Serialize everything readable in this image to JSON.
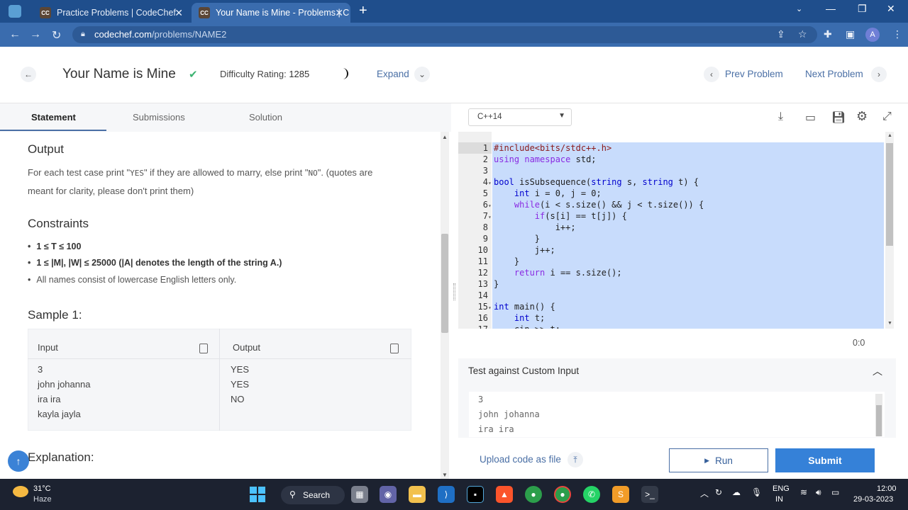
{
  "browser": {
    "tabs": [
      {
        "favicon": "CC",
        "title": "Practice Problems | CodeChef"
      },
      {
        "favicon": "CC",
        "title": "Your Name is Mine - Problems | C"
      }
    ],
    "url_host": "codechef.com",
    "url_path": "/problems/NAME2",
    "profile_initial": "A"
  },
  "header": {
    "title": "Your Name is Mine",
    "difficulty_label": "Difficulty Rating:",
    "difficulty_value": "1285",
    "expand_label": "Expand",
    "prev_label": "Prev Problem",
    "next_label": "Next Problem"
  },
  "statement_tabs": {
    "statement": "Statement",
    "submissions": "Submissions",
    "solution": "Solution"
  },
  "statement": {
    "output_heading": "Output",
    "output_text_1": "For each test case print \"",
    "yes_code": "YES",
    "output_text_2": "\" if they are allowed to marry, else print \"",
    "no_code": "NO",
    "output_text_3": "\". (quotes are",
    "output_text_4": "meant for clarity, please don't print them)",
    "constraints_heading": "Constraints",
    "constraints": [
      "1 ≤ T ≤ 100",
      "1 ≤ |M|, |W| ≤ 25000 (|A| denotes the length of the string A.)",
      "All names consist of lowercase English letters only."
    ],
    "sample_heading": "Sample 1:",
    "input_header": "Input",
    "output_header": "Output",
    "input_lines": [
      "3",
      "john johanna",
      "ira ira",
      "kayla jayla"
    ],
    "output_lines": [
      "YES",
      "YES",
      "NO"
    ],
    "explanation_heading": "Explanation:"
  },
  "editor": {
    "language": "C++14",
    "code_lines": [
      "#include<bits/stdc++.h>",
      "using namespace std;",
      "",
      "bool isSubsequence(string s, string t) {",
      "    int i = 0, j = 0;",
      "    while(i < s.size() && j < t.size()) {",
      "        if(s[i] == t[j]) {",
      "            i++;",
      "        }",
      "        j++;",
      "    }",
      "    return i == s.size();",
      "}",
      "",
      "int main() {",
      "    int t;",
      "    cin >> t;"
    ],
    "cursor_position": "0:0",
    "custom_input_title": "Test against Custom Input",
    "custom_input_lines": [
      "3",
      "john johanna",
      "ira ira"
    ],
    "upload_label": "Upload code as file",
    "run_label": "Run",
    "submit_label": "Submit"
  },
  "taskbar": {
    "temperature": "31°C",
    "weather": "Haze",
    "search_label": "Search",
    "lang_1": "ENG",
    "lang_2": "IN",
    "time": "12:00",
    "date": "29-03-2023"
  }
}
